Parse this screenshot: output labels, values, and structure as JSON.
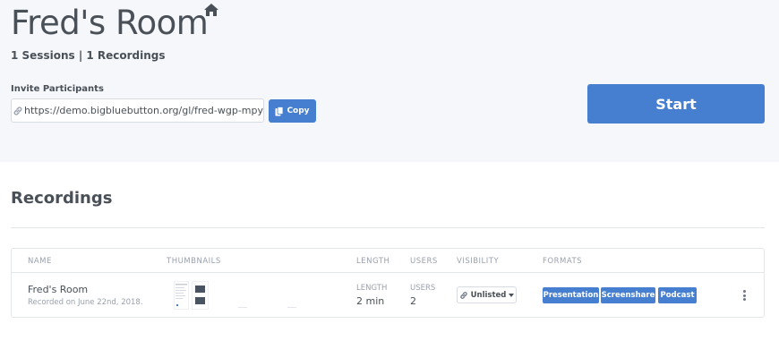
{
  "room": {
    "title": "Fred's Room",
    "stats": "1 Sessions | 1 Recordings",
    "invite_label": "Invite Participants",
    "invite_url": "https://demo.bigbluebutton.org/gl/fred-wgp-mpy",
    "copy_label": "Copy",
    "start_label": "Start"
  },
  "recordings": {
    "title": "Recordings",
    "columns": {
      "name": "NAME",
      "thumbnails": "THUMBNAILS",
      "length": "LENGTH",
      "users": "USERS",
      "visibility": "VISIBILITY",
      "formats": "FORMATS"
    },
    "rows": [
      {
        "name": "Fred's Room",
        "recorded_on": "Recorded on June 22nd, 2018.",
        "length_label": "LENGTH",
        "length_value": "2 min",
        "users_label": "USERS",
        "users_value": "2",
        "visibility": "Unlisted",
        "formats": [
          "Presentation",
          "Screenshare",
          "Podcast"
        ]
      }
    ]
  },
  "icons": {
    "home": "home-icon",
    "link": "link-icon",
    "copy": "clipboard-icon",
    "visibility": "link-icon",
    "more": "kebab-menu-icon"
  },
  "colors": {
    "primary": "#467fcf",
    "header_bg": "#f5f7fb",
    "text": "#495057",
    "muted": "#9aa0ac",
    "border": "#e3e6ea"
  }
}
